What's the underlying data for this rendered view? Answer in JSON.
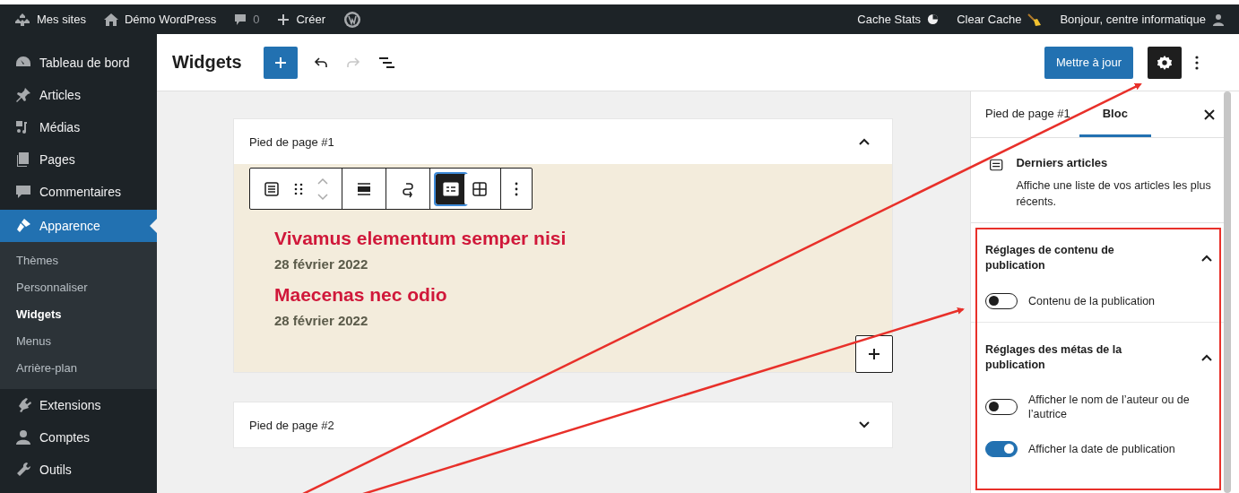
{
  "admin_bar": {
    "left": [
      {
        "kind": "sites",
        "label": "Mes sites"
      },
      {
        "kind": "home",
        "label": "Démo WordPress"
      },
      {
        "kind": "comments",
        "label": "0"
      },
      {
        "kind": "new",
        "label": "Créer"
      },
      {
        "kind": "wp"
      }
    ],
    "right": [
      {
        "kind": "stats",
        "label": "Cache Stats"
      },
      {
        "kind": "broom",
        "label": "Clear Cache"
      },
      {
        "kind": "user",
        "label": "Bonjour, centre informatique"
      }
    ]
  },
  "sidebar": {
    "items": [
      {
        "kind": "dashboard",
        "label": "Tableau de bord",
        "selected": false
      },
      {
        "kind": "pin",
        "label": "Articles",
        "selected": false
      },
      {
        "kind": "media",
        "label": "Médias",
        "selected": false
      },
      {
        "kind": "pages",
        "label": "Pages",
        "selected": false
      },
      {
        "kind": "comment",
        "label": "Commentaires",
        "selected": false
      },
      {
        "kind": "brush",
        "label": "Apparence",
        "selected": true,
        "children": [
          {
            "label": "Thèmes",
            "selected": false
          },
          {
            "label": "Personnaliser",
            "selected": false
          },
          {
            "label": "Widgets",
            "selected": true
          },
          {
            "label": "Menus",
            "selected": false
          },
          {
            "label": "Arrière-plan",
            "selected": false
          }
        ]
      },
      {
        "kind": "plug",
        "label": "Extensions",
        "selected": false
      },
      {
        "kind": "user",
        "label": "Comptes",
        "selected": false
      },
      {
        "kind": "wrench",
        "label": "Outils",
        "selected": false
      }
    ]
  },
  "header": {
    "title": "Widgets",
    "update_button": "Mettre à jour",
    "settings_pressed": true
  },
  "widget_areas": [
    {
      "title": "Pied de page #1",
      "expanded": true,
      "view_modes": [
        {
          "kind": "list",
          "selected": true
        },
        {
          "kind": "grid",
          "selected": false
        }
      ],
      "posts": [
        {
          "title": "Vivamus elementum semper nisi",
          "date": "28 février 2022"
        },
        {
          "title": "Maecenas nec odio",
          "date": "28 février 2022"
        }
      ]
    },
    {
      "title": "Pied de page #2",
      "expanded": false
    }
  ],
  "settings_panel": {
    "tabs": [
      {
        "label": "Pied de page #1",
        "selected": false
      },
      {
        "label": "Bloc",
        "selected": true
      }
    ],
    "block": {
      "name": "Derniers articles",
      "description": "Affiche une liste de vos articles les plus récents."
    },
    "sections": [
      {
        "title": "Réglages de contenu de publication",
        "expanded": true,
        "toggles": [
          {
            "label": "Contenu de la publication",
            "checked": false
          }
        ]
      },
      {
        "title": "Réglages des métas de la publication",
        "expanded": true,
        "toggles": [
          {
            "label": "Afficher le nom de l’auteur ou de l’autrice",
            "checked": false
          },
          {
            "label": "Afficher la date de publication",
            "checked": true
          }
        ]
      }
    ]
  }
}
